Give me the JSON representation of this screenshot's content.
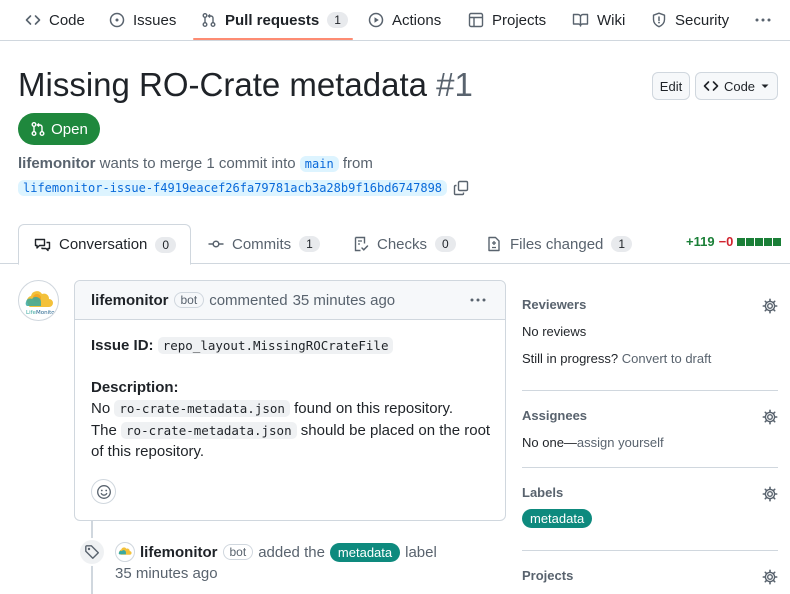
{
  "nav": {
    "items": [
      {
        "label": "Code",
        "icon": "code-icon"
      },
      {
        "label": "Issues",
        "icon": "issue-opened-icon"
      },
      {
        "label": "Pull requests",
        "icon": "git-pull-request-icon",
        "count": "1",
        "active": true
      },
      {
        "label": "Actions",
        "icon": "play-icon"
      },
      {
        "label": "Projects",
        "icon": "table-icon"
      },
      {
        "label": "Wiki",
        "icon": "book-icon"
      },
      {
        "label": "Security",
        "icon": "shield-icon"
      }
    ],
    "more": "more-options-icon"
  },
  "pr": {
    "title": "Missing RO-Crate metadata",
    "number": "#1",
    "state": "Open",
    "edit_label": "Edit",
    "code_label": "Code",
    "author": "lifemonitor",
    "merge_text_1": "wants to merge 1 commit into",
    "base_branch": "main",
    "merge_text_2": "from",
    "head_branch": "lifemonitor-issue-f4919eacef26fa79781acb3a28b9f16bd6747898"
  },
  "tabs": [
    {
      "label": "Conversation",
      "count": "0",
      "icon": "comment-discussion-icon"
    },
    {
      "label": "Commits",
      "count": "1",
      "icon": "git-commit-icon"
    },
    {
      "label": "Checks",
      "count": "0",
      "icon": "checklist-icon"
    },
    {
      "label": "Files changed",
      "count": "1",
      "icon": "file-diff-icon"
    }
  ],
  "diffstat": {
    "additions": "+119",
    "deletions": "−0"
  },
  "comment": {
    "author": "lifemonitor",
    "badge": "bot",
    "action": "commented",
    "time": "35 minutes ago",
    "issue_id_label": "Issue ID:",
    "issue_id": "repo_layout.MissingROCrateFile",
    "description_label": "Description:",
    "line1_a": "No",
    "line1_code": "ro-crate-metadata.json",
    "line1_b": "found on this repository.",
    "line2_a": "The",
    "line2_code": "ro-crate-metadata.json",
    "line2_b": "should be placed on the root",
    "line3": "of this repository."
  },
  "event": {
    "author": "lifemonitor",
    "badge": "bot",
    "action_a": "added the",
    "label": "metadata",
    "action_b": "label",
    "time": "35 minutes ago"
  },
  "sidebar": {
    "reviewers_title": "Reviewers",
    "reviewers_value": "No reviews",
    "progress_text": "Still in progress?",
    "progress_link": "Convert to draft",
    "assignees_title": "Assignees",
    "assignees_none": "No one—",
    "assignees_link": "assign yourself",
    "labels_title": "Labels",
    "label": "metadata",
    "projects_title": "Projects"
  },
  "colors": {
    "open": "#1f883d",
    "label": "#0e8a7e",
    "tab_underline": "#fd8c73"
  }
}
